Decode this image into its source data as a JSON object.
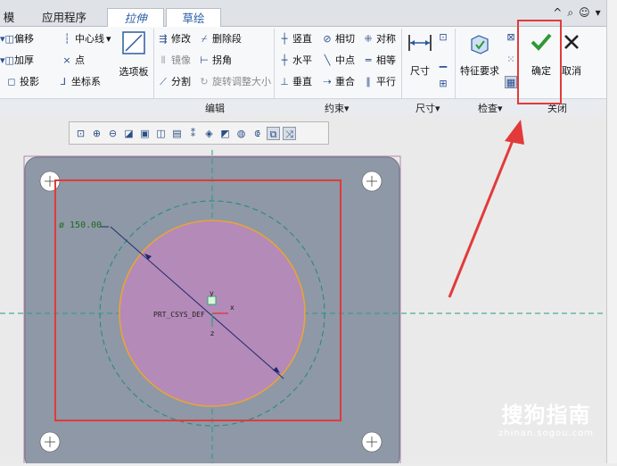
{
  "tabs": [
    "模",
    "应用程序",
    "拉伸",
    "草绘"
  ],
  "tab_icons": [
    "^",
    "⌕",
    "☺",
    "▾",
    "?"
  ],
  "ribbon": {
    "setup": {
      "offset": "偏移",
      "thicken": "加厚",
      "project": "投影",
      "centerline": "中心线",
      "point": "点",
      "coord": "坐标系",
      "palette": "选项板"
    },
    "edit": {
      "modify": "修改",
      "delete_segment": "删除段",
      "mirror": "镜像",
      "corner": "拐角",
      "divide": "分割",
      "rotate_resize": "旋转调整大小",
      "group_label": "编辑"
    },
    "constrain": {
      "vertical": "竖直",
      "tangent": "相切",
      "symmetric": "对称",
      "horizontal": "水平",
      "midpoint": "中点",
      "equal": "相等",
      "perpendicular": "垂直",
      "coincident": "重合",
      "parallel": "平行",
      "group_label": "约束▾"
    },
    "dimension": {
      "label": "尺寸",
      "group_label": "尺寸▾"
    },
    "inspect": {
      "feature_req": "特征要求",
      "group_label": "检查▾"
    },
    "close": {
      "ok": "确定",
      "cancel": "取消",
      "group_label": "关闭"
    }
  },
  "canvas": {
    "dimension_text": "ø 150.00",
    "csys_label": "PRT_CSYS_DEF",
    "axis_x": "x",
    "axis_y": "y",
    "axis_z": "z"
  },
  "watermark": {
    "line1": "搜狗指南",
    "line2": "zhinan.sogou.com"
  },
  "colors": {
    "plate": "#8e98a6",
    "circle_fill": "#b48ab8",
    "circle_stroke": "#e8a33a",
    "highlight": "#e23a3a",
    "check": "#2e9a35"
  }
}
